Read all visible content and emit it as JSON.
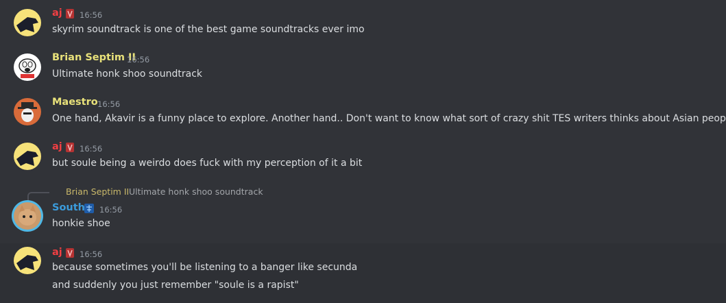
{
  "messages": [
    {
      "author": "aj",
      "author_color": "#f23f43",
      "time": "16:56",
      "text": "skyrim soundtrack is one of the best game soundtracks ever imo",
      "avatar": "crow-avatar"
    },
    {
      "author": "Brian Septim II",
      "author_color": "#e8e17a",
      "time": "16:56",
      "text": "Ultimate honk shoo soundtrack",
      "avatar": "cartoon-dog-avatar"
    },
    {
      "author": "Maestro",
      "author_color": "#e8e17a",
      "time": "16:56",
      "text": "One hand, Akavir is a funny place to explore. Another hand.. Don't want to know what sort of crazy shit TES writers thinks about Asian people.",
      "avatar": "hat-man-avatar"
    },
    {
      "author": "aj",
      "author_color": "#f23f43",
      "time": "16:56",
      "text": "but soule being a weirdo does fuck with my perception of it a bit",
      "avatar": "crow-avatar"
    },
    {
      "author": "South",
      "author_color": "#3b9bdb",
      "time": "16:56",
      "text": "honkie shoe",
      "avatar": "cat-avatar",
      "reply": {
        "author": "Brian Septim II",
        "text": "Ultimate honk shoo soundtrack"
      }
    },
    {
      "author": "aj",
      "author_color": "#f23f43",
      "time": "16:56",
      "text": "because sometimes you'll be listening to a banger like secunda",
      "text2": "and suddenly you just remember \"soule is a rapist\"",
      "avatar": "crow-avatar"
    }
  ]
}
